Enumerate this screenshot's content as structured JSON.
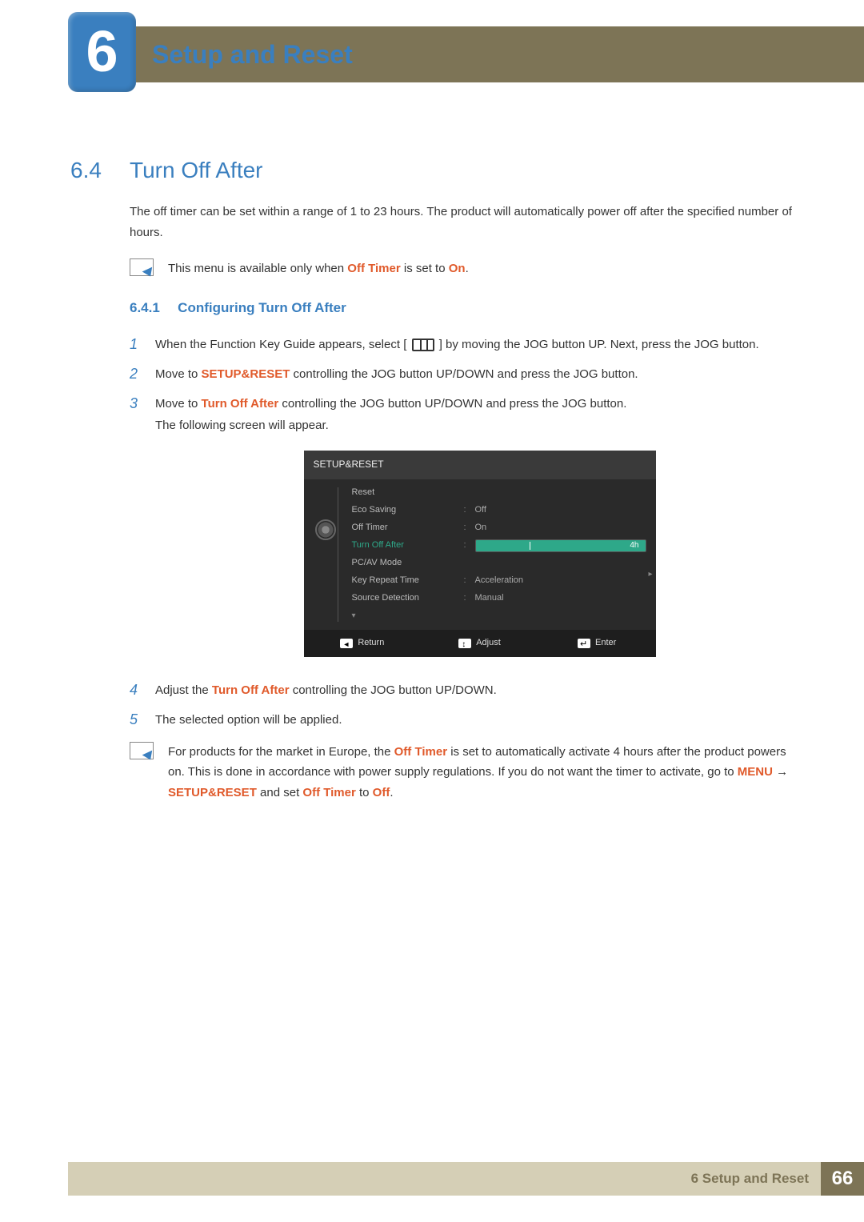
{
  "header": {
    "chapter_num": "6",
    "chapter_title": "Setup and Reset"
  },
  "section": {
    "num": "6.4",
    "title": "Turn Off After"
  },
  "intro": "The off timer can be set within a range of 1 to 23 hours. The product will automatically power off after the specified number of hours.",
  "note1": {
    "pre": "This menu is available only when ",
    "b1": "Off Timer",
    "mid": " is set to ",
    "b2": "On",
    "post": "."
  },
  "subsection": {
    "num": "6.4.1",
    "title": "Configuring Turn Off After"
  },
  "steps": {
    "s1": {
      "num": "1",
      "pre": "When the Function Key Guide appears, select ",
      "post": " by moving the JOG button UP. Next, press the JOG button."
    },
    "s2": {
      "num": "2",
      "pre": "Move to ",
      "b1": "SETUP&RESET",
      "post": " controlling the JOG button UP/DOWN and press the JOG button."
    },
    "s3": {
      "num": "3",
      "pre": "Move to ",
      "b1": "Turn Off After",
      "mid": " controlling the JOG button UP/DOWN and press the JOG button.",
      "post": "The following screen will appear."
    },
    "s4": {
      "num": "4",
      "pre": "Adjust the ",
      "b1": "Turn Off After",
      "post": " controlling the JOG button UP/DOWN."
    },
    "s5": {
      "num": "5",
      "text": "The selected option will be applied."
    }
  },
  "osd": {
    "title": "SETUP&RESET",
    "rows": {
      "reset": "Reset",
      "eco": "Eco Saving",
      "eco_v": "Off",
      "offt": "Off Timer",
      "offt_v": "On",
      "toa": "Turn Off After",
      "toa_v": "4h",
      "pcav": "PC/AV Mode",
      "krt": "Key Repeat Time",
      "krt_v": "Acceleration",
      "sd": "Source Detection",
      "sd_v": "Manual"
    },
    "footer": {
      "ret": "Return",
      "adj": "Adjust",
      "ent": "Enter"
    }
  },
  "note2": {
    "t1": "For products for the market in Europe, the ",
    "b1": "Off Timer",
    "t2": " is set to automatically activate 4 hours after the product powers on. This is done in accordance with power supply regulations. If you do not want the timer to activate, go to ",
    "b2": "MENU",
    "arrow": " → ",
    "b3": "SETUP&RESET",
    "t3": " and set ",
    "b4": "Off Timer",
    "t4": " to ",
    "b5": "Off",
    "t5": "."
  },
  "footer": {
    "text": "6 Setup and Reset",
    "page": "66"
  }
}
